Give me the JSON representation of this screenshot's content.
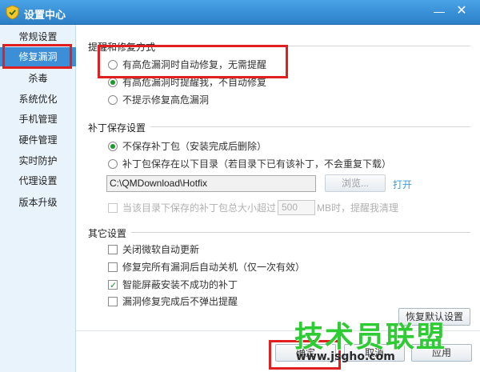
{
  "window": {
    "title": "设置中心",
    "minimize_glyph": "—",
    "close_glyph": "✕"
  },
  "sidebar": {
    "items": [
      {
        "label": "常规设置"
      },
      {
        "label": "修复漏洞",
        "active": true
      },
      {
        "label": "杀毒"
      },
      {
        "label": "系统优化"
      },
      {
        "label": "手机管理"
      },
      {
        "label": "硬件管理"
      },
      {
        "label": "实时防护"
      },
      {
        "label": "代理设置"
      },
      {
        "label": "版本升级"
      }
    ]
  },
  "repair_mode": {
    "heading": "提醒和修复方式",
    "options": [
      {
        "label": "有高危漏洞时自动修复，无需提醒",
        "selected": false
      },
      {
        "label": "有高危漏洞时提醒我，不自动修复",
        "selected": true
      },
      {
        "label": "不提示修复高危漏洞",
        "selected": false
      }
    ]
  },
  "patch_save": {
    "heading": "补丁保存设置",
    "options": [
      {
        "label": "不保存补丁包（安装完成后删除）",
        "selected": true
      },
      {
        "label": "补丁包保存在以下目录（若目录下已有该补丁，不会重复下载）",
        "selected": false
      }
    ],
    "path_value": "C:\\QMDownload\\Hotfix",
    "browse_label": "浏览...",
    "open_label": "打开",
    "cleanup": {
      "label_before": "当该目录下保存的补丁包总大小超过",
      "size_value": "500",
      "label_after": "MB时，提醒我清理",
      "checked": false
    }
  },
  "other": {
    "heading": "其它设置",
    "options": [
      {
        "label": "关闭微软自动更新",
        "checked": false
      },
      {
        "label": "修复完所有漏洞后自动关机（仅一次有效）",
        "checked": false
      },
      {
        "label": "智能屏蔽安装不成功的补丁",
        "checked": true
      },
      {
        "label": "漏洞修复完成后不弹出提醒",
        "checked": false
      }
    ],
    "restore_label": "恢复默认设置"
  },
  "footer": {
    "ok_label": "确定",
    "cancel_label": "取消",
    "apply_label": "应用"
  },
  "watermark": {
    "logo_text": "技术员联盟",
    "url_text": "www.jsgho.com"
  },
  "colors": {
    "title_bar": "#2b7fc8",
    "active_nav": "#3c8fd6",
    "accent_green": "#1a9a2a",
    "highlight_red": "#e02020",
    "link_blue": "#3a9bd8"
  }
}
